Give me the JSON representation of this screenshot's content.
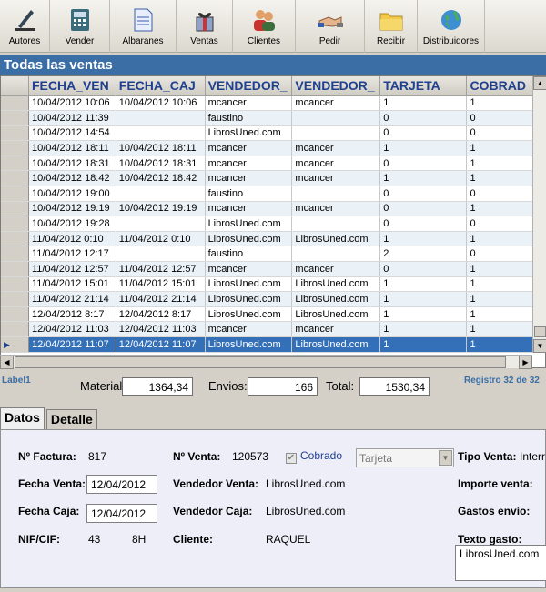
{
  "toolbar": [
    {
      "label": "Autores",
      "icon": "pen-icon"
    },
    {
      "label": "Vender",
      "icon": "cash-register-icon"
    },
    {
      "label": "Albaranes",
      "icon": "document-icon"
    },
    {
      "label": "Ventas",
      "icon": "gift-icon"
    },
    {
      "label": "Clientes",
      "icon": "people-icon"
    },
    {
      "label": "Pedir",
      "icon": "handshake-icon"
    },
    {
      "label": "Recibir",
      "icon": "folder-icon"
    },
    {
      "label": "Distribuidores",
      "icon": "globe-icon"
    }
  ],
  "title": "Todas las ventas",
  "grid": {
    "columns": [
      "FECHA_VEN",
      "FECHA_CAJ",
      "VENDEDOR_",
      "VENDEDOR_",
      "TARJETA",
      "COBRAD"
    ],
    "rows": [
      [
        "10/04/2012 10:06",
        "10/04/2012 10:06",
        "mcancer",
        "mcancer",
        "1",
        "1"
      ],
      [
        "10/04/2012 11:39",
        "",
        "faustino",
        "",
        "0",
        "0"
      ],
      [
        "10/04/2012 14:54",
        "",
        "LibrosUned.com",
        "",
        "0",
        "0"
      ],
      [
        "10/04/2012 18:11",
        "10/04/2012 18:11",
        "mcancer",
        "mcancer",
        "1",
        "1"
      ],
      [
        "10/04/2012 18:31",
        "10/04/2012 18:31",
        "mcancer",
        "mcancer",
        "0",
        "1"
      ],
      [
        "10/04/2012 18:42",
        "10/04/2012 18:42",
        "mcancer",
        "mcancer",
        "1",
        "1"
      ],
      [
        "10/04/2012 19:00",
        "",
        "faustino",
        "",
        "0",
        "0"
      ],
      [
        "10/04/2012 19:19",
        "10/04/2012 19:19",
        "mcancer",
        "mcancer",
        "0",
        "1"
      ],
      [
        "10/04/2012 19:28",
        "",
        "LibrosUned.com",
        "",
        "0",
        "0"
      ],
      [
        "11/04/2012 0:10",
        "11/04/2012 0:10",
        "LibrosUned.com",
        "LibrosUned.com",
        "1",
        "1"
      ],
      [
        "11/04/2012 12:17",
        "",
        "faustino",
        "",
        "2",
        "0"
      ],
      [
        "11/04/2012 12:57",
        "11/04/2012 12:57",
        "mcancer",
        "mcancer",
        "0",
        "1"
      ],
      [
        "11/04/2012 15:01",
        "11/04/2012 15:01",
        "LibrosUned.com",
        "LibrosUned.com",
        "1",
        "1"
      ],
      [
        "11/04/2012 21:14",
        "11/04/2012 21:14",
        "LibrosUned.com",
        "LibrosUned.com",
        "1",
        "1"
      ],
      [
        "12/04/2012 8:17",
        "12/04/2012 8:17",
        "LibrosUned.com",
        "LibrosUned.com",
        "1",
        "1"
      ],
      [
        "12/04/2012 11:03",
        "12/04/2012 11:03",
        "mcancer",
        "mcancer",
        "1",
        "1"
      ],
      [
        "12/04/2012 11:07",
        "12/04/2012 11:07",
        "LibrosUned.com",
        "LibrosUned.com",
        "1",
        "1"
      ]
    ],
    "selected_row": 16
  },
  "totals": {
    "label1": "Label1",
    "material_label": "Material:",
    "material_value": "1364,34",
    "envios_label": "Envios:",
    "envios_value": "166",
    "total_label": "Total:",
    "total_value": "1530,34",
    "registro": "Registro 32 de 32"
  },
  "tabs": [
    "Datos",
    "Detalle"
  ],
  "detail": {
    "factura_label": "Nº Factura:",
    "factura_value": "817",
    "venta_label": "Nº Venta:",
    "venta_value": "120573",
    "cobrado_label": "Cobrado",
    "tarjeta_value": "Tarjeta",
    "tipo_venta_label": "Tipo Venta:",
    "tipo_venta_value": "Interr",
    "fecha_venta_label": "Fecha Venta:",
    "fecha_venta_value": "12/04/2012",
    "vendedor_venta_label": "Vendedor Venta:",
    "vendedor_venta_value": "LibrosUned.com",
    "importe_label": "Importe venta:",
    "fecha_caja_label": "Fecha Caja:",
    "fecha_caja_value": "12/04/2012",
    "vendedor_caja_label": "Vendedor Caja:",
    "vendedor_caja_value": "LibrosUned.com",
    "gastos_label": "Gastos envío:",
    "nif_label": "NIF/CIF:",
    "nif_value_a": "43",
    "nif_value_b": "8H",
    "cliente_label": "Cliente:",
    "cliente_value": "RAQUEL",
    "texto_gasto_label": "Texto gasto:",
    "texto_gasto_value": "LibrosUned.com"
  }
}
